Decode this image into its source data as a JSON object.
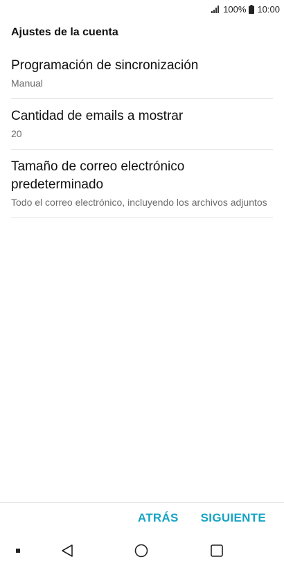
{
  "status_bar": {
    "battery": "100%",
    "clock": "10:00",
    "icons": [
      "signal-icon",
      "battery-icon"
    ]
  },
  "header": {
    "title": "Ajustes de la cuenta"
  },
  "settings": [
    {
      "title": "Programación de sincronización",
      "value": "Manual"
    },
    {
      "title": "Cantidad de emails a mostrar",
      "value": "20"
    },
    {
      "title": "Tamaño de correo electrónico predeterminado",
      "value": "Todo el correo electrónico, incluyendo los archivos adjuntos"
    }
  ],
  "actions": {
    "back_label": "ATRÁS",
    "next_label": "SIGUIENTE"
  },
  "nav_bar": {
    "icons": [
      "dot-icon",
      "back-triangle-icon",
      "home-circle-icon",
      "recents-square-icon"
    ]
  },
  "colors": {
    "accent": "#15a3c4",
    "text_primary": "#111111",
    "text_secondary": "#6b6b6b",
    "divider": "#e2e2e2"
  }
}
